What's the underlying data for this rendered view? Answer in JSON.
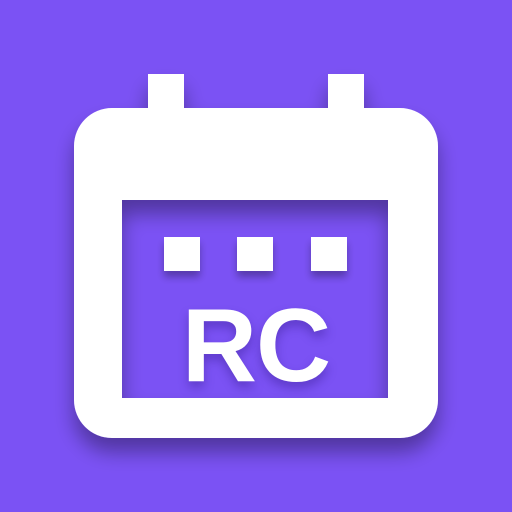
{
  "app_icon": {
    "icon": "calendar-icon",
    "label": "RC",
    "colors": {
      "background": "#7b52f4",
      "foreground": "#ffffff"
    }
  }
}
